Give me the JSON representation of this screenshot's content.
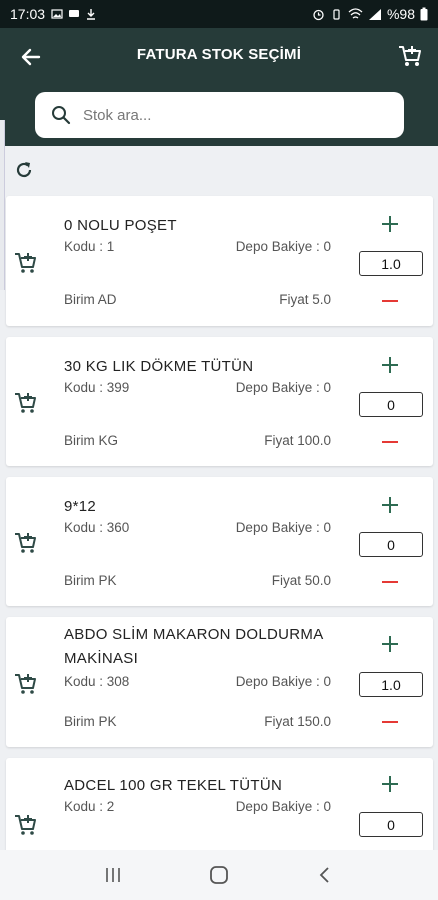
{
  "status": {
    "time": "17:03",
    "battery": "%98"
  },
  "header": {
    "title": "FATURA STOK SEÇİMİ"
  },
  "search": {
    "placeholder": "Stok ara..."
  },
  "colors": {
    "accent": "#263b39",
    "plus": "#2e6b52",
    "minus": "#e53935"
  },
  "items": [
    {
      "name": "0 NOLU POŞET",
      "code": "Kodu : 1",
      "depo": "Depo Bakiye : 0",
      "birim": "Birim AD",
      "fiyat": "Fiyat 5.0",
      "qty": "1.0"
    },
    {
      "name": "30 KG LIK DÖKME TÜTÜN",
      "code": "Kodu : 399",
      "depo": "Depo Bakiye : 0",
      "birim": "Birim KG",
      "fiyat": "Fiyat 100.0",
      "qty": "0"
    },
    {
      "name": "9*12",
      "code": "Kodu : 360",
      "depo": "Depo Bakiye : 0",
      "birim": "Birim PK",
      "fiyat": "Fiyat 50.0",
      "qty": "0"
    },
    {
      "name": "ABDO SLİM MAKARON DOLDURMA MAKİNASI",
      "code": "Kodu : 308",
      "depo": "Depo Bakiye : 0",
      "birim": "Birim PK",
      "fiyat": "Fiyat 150.0",
      "qty": "1.0"
    },
    {
      "name": "ADCEL 100 GR TEKEL TÜTÜN",
      "code": "Kodu : 2",
      "depo": "Depo Bakiye : 0",
      "birim": "",
      "fiyat": "",
      "qty": "0"
    }
  ]
}
